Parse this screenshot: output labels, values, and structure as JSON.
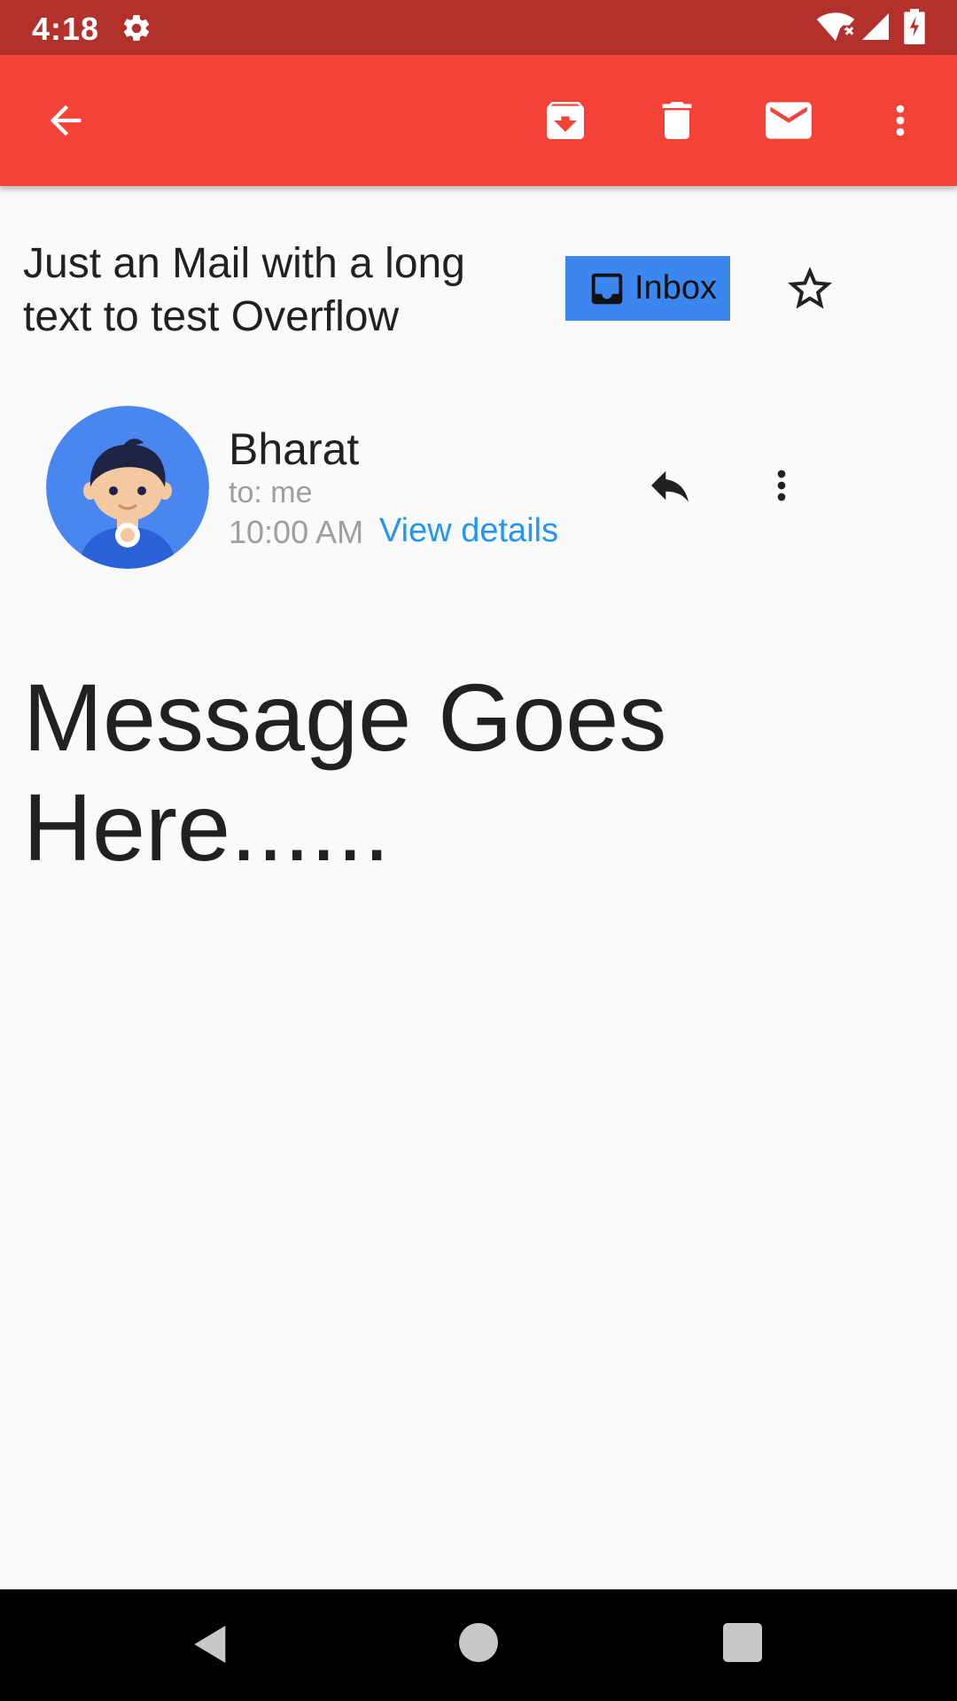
{
  "status_bar": {
    "time": "4:18",
    "icons": [
      "gear-icon",
      "wifi-icon",
      "signal-icon",
      "battery-icon"
    ]
  },
  "toolbar": {
    "icons": [
      "back-arrow-icon",
      "archive-icon",
      "delete-icon",
      "mail-icon",
      "more-vert-icon"
    ]
  },
  "email": {
    "subject": "Just an Mail with a long text to test Overflow",
    "label": "Inbox",
    "sender": "Bharat",
    "to": "to: me",
    "time": "10:00 AM",
    "view_details": "View details",
    "body": "Message Goes Here......"
  },
  "colors": {
    "status_bar": "#b3302b",
    "toolbar": "#f44336",
    "inbox_chip": "#3b86ef",
    "link": "#2196f3",
    "secondary_text": "#9e9e9e"
  },
  "nav_bar": {
    "icons": [
      "nav-back-icon",
      "nav-home-icon",
      "nav-recents-icon"
    ]
  }
}
